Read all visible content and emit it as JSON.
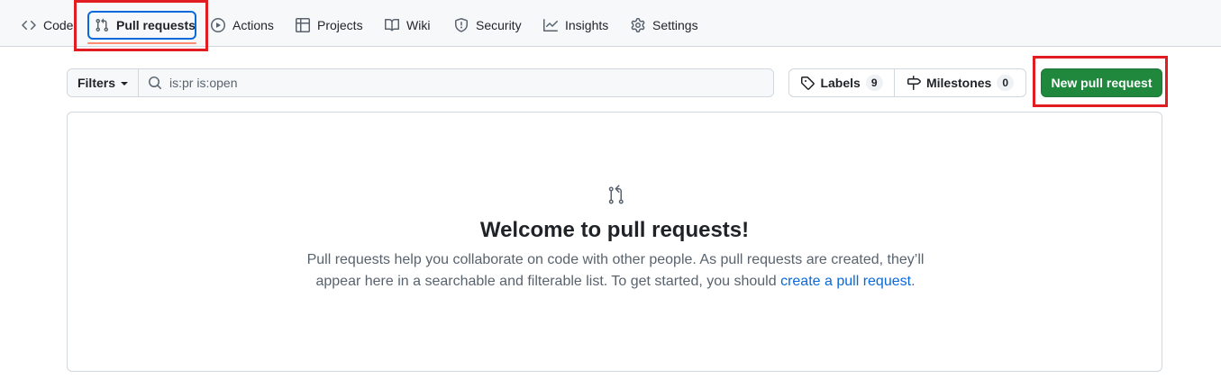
{
  "nav": {
    "items": [
      {
        "label": "Code",
        "icon": "code-icon"
      },
      {
        "label": "Pull requests",
        "icon": "git-pull-request-icon",
        "selected": true
      },
      {
        "label": "Actions",
        "icon": "play-icon"
      },
      {
        "label": "Projects",
        "icon": "table-icon"
      },
      {
        "label": "Wiki",
        "icon": "book-icon"
      },
      {
        "label": "Security",
        "icon": "shield-icon"
      },
      {
        "label": "Insights",
        "icon": "graph-icon"
      },
      {
        "label": "Settings",
        "icon": "gear-icon"
      }
    ]
  },
  "subnav": {
    "filters_label": "Filters",
    "search_value": "is:pr is:open",
    "labels_label": "Labels",
    "labels_count": "9",
    "milestones_label": "Milestones",
    "milestones_count": "0",
    "new_button_label": "New pull request"
  },
  "blankslate": {
    "icon": "git-pull-request-icon",
    "title": "Welcome to pull requests!",
    "text_before": "Pull requests help you collaborate on code with other people. As pull requests are created, they’ll appear here in a searchable and filterable list. To get started, you should ",
    "link_text": "create a pull request",
    "text_after": "."
  },
  "colors": {
    "accent": "#0969da",
    "primary_button": "#1f883d",
    "selected_underline": "#fd8c73",
    "highlight_annotation": "#e11d21"
  }
}
